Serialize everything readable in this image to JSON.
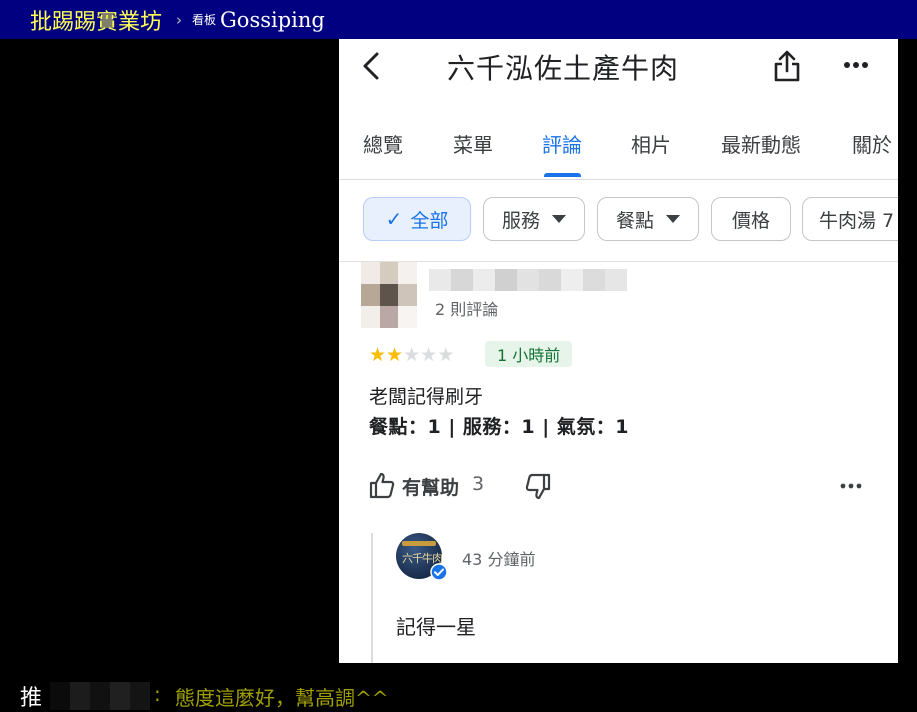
{
  "ptt": {
    "site_name": "批踢踢實業坊",
    "separator": "›",
    "board_label": "看板",
    "board_name": "Gossiping"
  },
  "maps": {
    "place_title": "六千泓佐土產牛肉",
    "tabs": [
      {
        "label": "總覽"
      },
      {
        "label": "菜單"
      },
      {
        "label": "評論"
      },
      {
        "label": "相片"
      },
      {
        "label": "最新動態"
      },
      {
        "label": "關於"
      }
    ],
    "active_tab": "評論",
    "chips": [
      {
        "label": "全部",
        "selected": true,
        "check": "✓"
      },
      {
        "label": "服務",
        "dropdown": true
      },
      {
        "label": "餐點",
        "dropdown": true
      },
      {
        "label": "價格"
      },
      {
        "label": "牛肉湯 7"
      }
    ],
    "review": {
      "review_count": "2 則評論",
      "rating": 2,
      "max_rating": 5,
      "time_ago": "1 小時前",
      "text": "老闆記得刷牙",
      "sub_ratings": "餐點：1 | 服務：1 | 氣氛：1",
      "helpful_label": "有幫助",
      "helpful_count": "3"
    },
    "owner_reply": {
      "time_ago": "43 分鐘前",
      "text": "記得一星",
      "avatar_text": "六千牛肉"
    }
  },
  "push": {
    "tag": "推",
    "colon": ":",
    "content": "態度這麼好，幫高調^^"
  },
  "colors": {
    "ptt_header_bg": "#000080",
    "ptt_yellow": "#ffff55",
    "push_text": "#a0a000",
    "accent_blue": "#1a73e8",
    "star_yellow": "#fbbc04",
    "badge_green_bg": "#e6f4ea",
    "badge_green_text": "#137333"
  }
}
